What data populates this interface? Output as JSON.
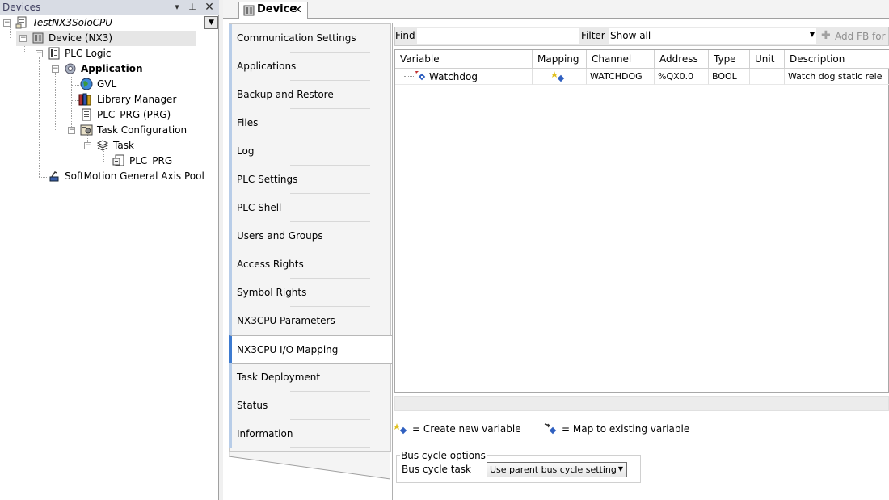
{
  "devices_panel": {
    "title": "Devices",
    "tree": [
      {
        "label": "TestNX3SoloCPU",
        "icon": "project-icon",
        "italic": true
      },
      {
        "label": "Device (NX3)",
        "icon": "device-icon",
        "selected": true
      },
      {
        "label": "PLC Logic",
        "icon": "plc-logic-icon"
      },
      {
        "label": "Application",
        "icon": "application-gear-icon",
        "bold": true
      },
      {
        "label": "GVL",
        "icon": "globe-icon"
      },
      {
        "label": "Library Manager",
        "icon": "books-icon"
      },
      {
        "label": "PLC_PRG (PRG)",
        "icon": "document-icon"
      },
      {
        "label": "Task Configuration",
        "icon": "task-config-icon"
      },
      {
        "label": "Task",
        "icon": "task-stack-icon"
      },
      {
        "label": "PLC_PRG",
        "icon": "program-call-icon"
      },
      {
        "label": "SoftMotion General Axis Pool",
        "icon": "axis-pool-icon"
      }
    ]
  },
  "editor": {
    "tab_label": "Device",
    "subtabs": [
      "Communication Settings",
      "Applications",
      "Backup and Restore",
      "Files",
      "Log",
      "PLC Settings",
      "PLC Shell",
      "Users and Groups",
      "Access Rights",
      "Symbol Rights",
      "NX3CPU Parameters",
      "NX3CPU I/O Mapping",
      "Task Deployment",
      "Status",
      "Information"
    ],
    "active_subtab": "NX3CPU I/O Mapping"
  },
  "mapping": {
    "find_label": "Find",
    "find_value": "",
    "filter_label": "Filter",
    "filter_value": "Show all",
    "add_fb_label": "Add FB for IO",
    "columns": [
      "Variable",
      "Mapping",
      "Channel",
      "Address",
      "Type",
      "Unit",
      "Description"
    ],
    "rows": [
      {
        "Variable": "Watchdog",
        "Mapping": "create-new-variable-icon",
        "Channel": "WATCHDOG",
        "Address": "%QX0.0",
        "Type": "BOOL",
        "Unit": "",
        "Description": "Watch dog static rele"
      }
    ],
    "legend": {
      "create_new": "= Create new variable",
      "map_existing": "= Map to existing variable"
    },
    "bus_cycle": {
      "group_title": "Bus cycle options",
      "task_label": "Bus cycle task",
      "task_value": "Use parent bus cycle setting"
    }
  },
  "colors": {
    "title_bar": "#d8dce4",
    "active_subtab_accent": "#3d7bd0",
    "inactive_subtab_accent": "#b8cde8"
  }
}
